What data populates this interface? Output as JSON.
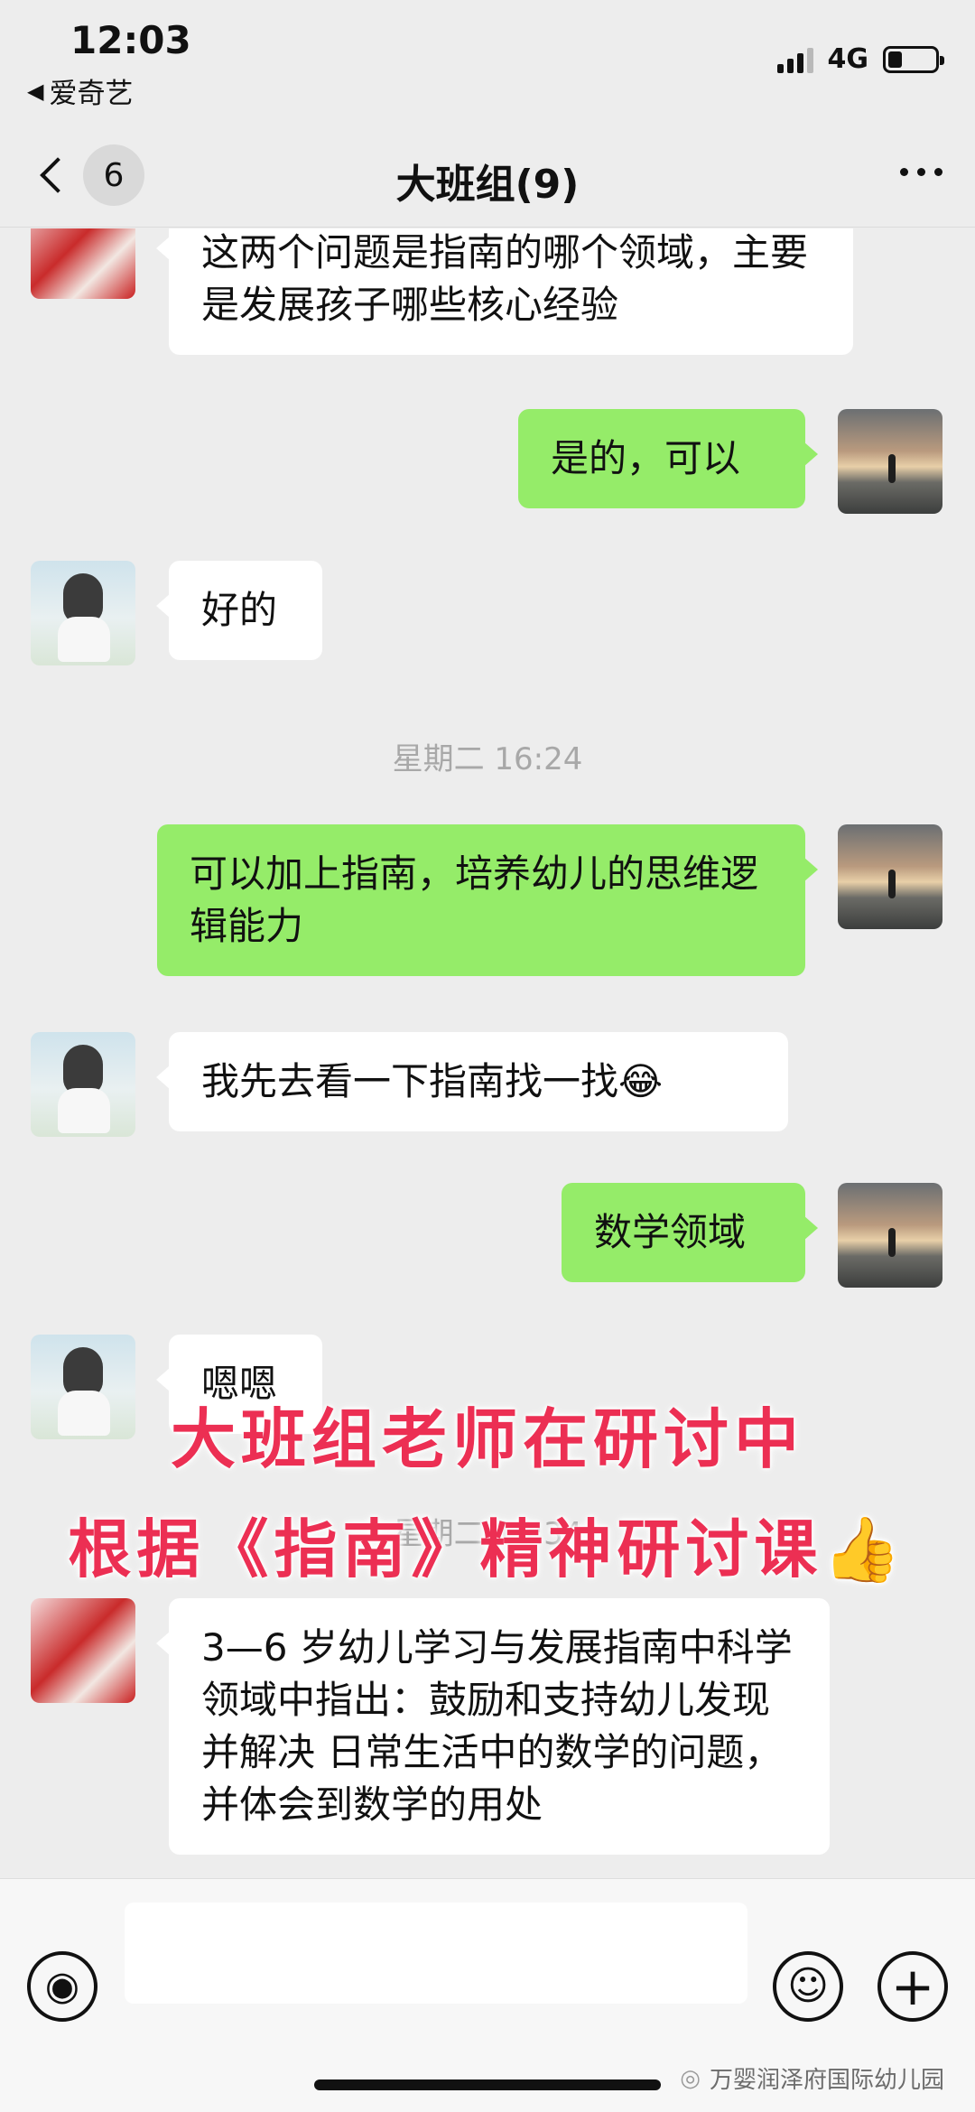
{
  "status_bar": {
    "time": "12:03",
    "back_app": "爱奇艺",
    "back_app_arrow": "◀",
    "network": "4G"
  },
  "nav": {
    "unread_count": "6",
    "title": "大班组(9)"
  },
  "messages": [
    {
      "side": "in",
      "avatar": "avatar-a",
      "text": "这两个问题是指南的哪个领域，主要是发展孩子哪些核心经验"
    },
    {
      "side": "out",
      "avatar": "avatar-c",
      "text": "是的，可以"
    },
    {
      "side": "in",
      "avatar": "avatar-b",
      "text": "好的"
    },
    {
      "type": "timestamp",
      "text": "星期二 16:24"
    },
    {
      "side": "out",
      "avatar": "avatar-c",
      "text": "可以加上指南，培养幼儿的思维逻辑能力"
    },
    {
      "side": "in",
      "avatar": "avatar-b",
      "text": "我先去看一下指南找一找😂"
    },
    {
      "side": "out",
      "avatar": "avatar-c",
      "text": "数学领域"
    },
    {
      "side": "in",
      "avatar": "avatar-b",
      "text": "嗯嗯"
    },
    {
      "type": "timestamp",
      "text": "星期二 16:34"
    },
    {
      "side": "in",
      "avatar": "avatar-a",
      "text": "3—6 岁幼儿学习与发展指南中科学领域中指出：鼓励和支持幼儿发现并解决 日常生活中的数学的问题，并体会到数学的用处"
    }
  ],
  "overlay": {
    "line1": "大班组老师在研讨中",
    "line2": "根据《指南》精神研讨课👍"
  },
  "input_bar": {
    "input_value": "",
    "plus_glyph": "+",
    "emoji_glyph": "☺",
    "voice_glyph": "◉"
  },
  "watermark": "万婴润泽府国际幼儿园",
  "icons": {
    "voice": "voice-icon",
    "emoji": "emoji-icon",
    "plus": "plus-icon",
    "back": "chevron-left-icon",
    "more": "more-dots-icon",
    "wechat": "wechat-logo-icon"
  },
  "colors": {
    "outgoing_bubble": "#95ec69",
    "incoming_bubble": "#ffffff",
    "background": "#ededed",
    "overlay_text": "#ec2f53"
  }
}
